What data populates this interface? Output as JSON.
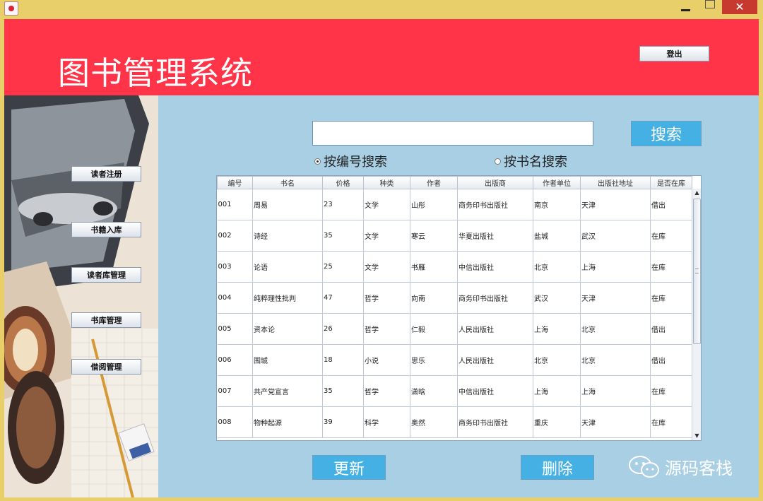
{
  "window": {
    "controls": {
      "minimize_icon": "minimize-icon",
      "maximize_icon": "maximize-icon",
      "close_glyph": "✕"
    }
  },
  "header": {
    "title": "图书管理系统",
    "logout_label": "登出"
  },
  "sidebar": {
    "items": [
      {
        "label": "读者注册"
      },
      {
        "label": "书籍入库"
      },
      {
        "label": "读者库管理"
      },
      {
        "label": "书库管理"
      },
      {
        "label": "借阅管理"
      }
    ]
  },
  "search": {
    "input_value": "",
    "button_label": "搜索",
    "radio_by_id": "按编号搜索",
    "radio_by_name": "按书名搜索",
    "selected": "by_id"
  },
  "table": {
    "columns": [
      "编号",
      "书名",
      "价格",
      "种类",
      "作者",
      "出版商",
      "作者单位",
      "出版社地址",
      "是否在库"
    ],
    "rows": [
      [
        "001",
        "周易",
        "23",
        "文学",
        "山彤",
        "商务印书出版社",
        "南京",
        "天津",
        "借出"
      ],
      [
        "002",
        "诗经",
        "35",
        "文学",
        "寒云",
        "华夏出版社",
        "盐城",
        "武汉",
        "在库"
      ],
      [
        "003",
        "论语",
        "25",
        "文学",
        "书雁",
        "中信出版社",
        "北京",
        "上海",
        "在库"
      ],
      [
        "004",
        "纯粹理性批判",
        "47",
        "哲学",
        "向南",
        "商务印书出版社",
        "武汉",
        "天津",
        "在库"
      ],
      [
        "005",
        "资本论",
        "26",
        "哲学",
        "仁毅",
        "人民出版社",
        "上海",
        "北京",
        "借出"
      ],
      [
        "006",
        "围城",
        "18",
        "小说",
        "思乐",
        "人民出版社",
        "北京",
        "北京",
        "借出"
      ],
      [
        "007",
        "共产党宣言",
        "35",
        "哲学",
        "潇晗",
        "中信出版社",
        "上海",
        "上海",
        "在库"
      ],
      [
        "008",
        "物种起源",
        "39",
        "科学",
        "奥然",
        "商务印书出版社",
        "重庆",
        "天津",
        "在库"
      ]
    ]
  },
  "actions": {
    "update_label": "更新",
    "delete_label": "删除"
  },
  "watermark": {
    "text": "源码客栈"
  },
  "colors": {
    "header_bg": "#ff3448",
    "content_bg": "#a9cfe5",
    "button_blue": "#44b0e4",
    "window_frame": "#e8cf6a",
    "close_red": "#c7382f"
  }
}
